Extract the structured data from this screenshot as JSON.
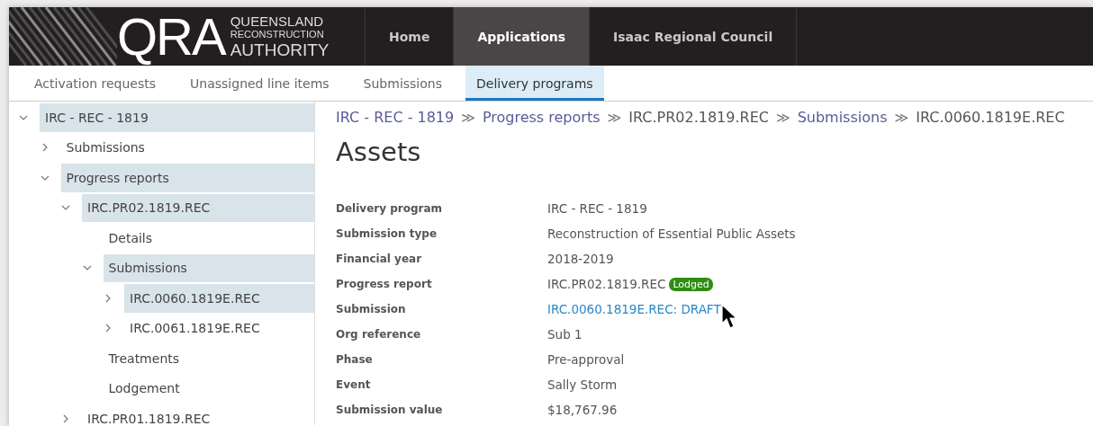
{
  "logo": {
    "mark": "QRA",
    "lines": [
      "QUEENSLAND",
      "RECONSTRUCTION",
      "AUTHORITY"
    ]
  },
  "nav": [
    {
      "label": "Home",
      "selected": false
    },
    {
      "label": "Applications",
      "selected": true
    },
    {
      "label": "Isaac Regional Council",
      "selected": false
    }
  ],
  "tabs": [
    {
      "label": "Activation requests",
      "selected": false
    },
    {
      "label": "Unassigned line items",
      "selected": false
    },
    {
      "label": "Submissions",
      "selected": false
    },
    {
      "label": "Delivery programs",
      "selected": true
    }
  ],
  "tree": [
    {
      "label": "IRC - REC - 1819",
      "kind": "folder",
      "expanded": true,
      "selected": true,
      "children": [
        {
          "label": "Submissions",
          "kind": "folder",
          "expanded": false,
          "selected": false
        },
        {
          "label": "Progress reports",
          "kind": "folder",
          "expanded": true,
          "selected": true,
          "children": [
            {
              "label": "IRC.PR02.1819.REC",
              "kind": "folder",
              "expanded": true,
              "selected": true,
              "children": [
                {
                  "label": "Details",
                  "kind": "page",
                  "selected": false
                },
                {
                  "label": "Submissions",
                  "kind": "folder",
                  "expanded": true,
                  "selected": true,
                  "children": [
                    {
                      "label": "IRC.0060.1819E.REC",
                      "kind": "folder",
                      "expanded": false,
                      "selected": true
                    },
                    {
                      "label": "IRC.0061.1819E.REC",
                      "kind": "folder",
                      "expanded": false,
                      "selected": false
                    }
                  ]
                },
                {
                  "label": "Treatments",
                  "kind": "page",
                  "selected": false
                },
                {
                  "label": "Lodgement",
                  "kind": "page",
                  "selected": false
                }
              ]
            },
            {
              "label": "IRC.PR01.1819.REC",
              "kind": "folder",
              "expanded": false,
              "selected": false
            }
          ]
        }
      ]
    }
  ],
  "breadcrumb": [
    {
      "label": "IRC - REC - 1819",
      "kind": "link"
    },
    {
      "label": "Progress reports",
      "kind": "link"
    },
    {
      "label": "IRC.PR02.1819.REC",
      "kind": "text"
    },
    {
      "label": "Submissions",
      "kind": "link"
    },
    {
      "label": "IRC.0060.1819E.REC",
      "kind": "text"
    }
  ],
  "breadcrumb_separator": "≫",
  "title": "Assets",
  "details": [
    {
      "label": "Delivery program",
      "value": "IRC - REC - 1819",
      "kind": "text"
    },
    {
      "label": "Submission type",
      "value": "Reconstruction of Essential Public Assets",
      "kind": "text"
    },
    {
      "label": "Financial year",
      "value": "2018-2019",
      "kind": "text"
    },
    {
      "label": "Progress report",
      "value": "IRC.PR02.1819.REC",
      "kind": "text",
      "badge": "Lodged"
    },
    {
      "label": "Submission",
      "value": "IRC.0060.1819E.REC: DRAFT",
      "kind": "link"
    },
    {
      "label": "Org reference",
      "value": "Sub 1",
      "kind": "text"
    },
    {
      "label": "Phase",
      "value": "Pre-approval",
      "kind": "text"
    },
    {
      "label": "Event",
      "value": "Sally Storm",
      "kind": "text"
    },
    {
      "label": "Submission value",
      "value": "$18,767.96",
      "kind": "text"
    }
  ]
}
